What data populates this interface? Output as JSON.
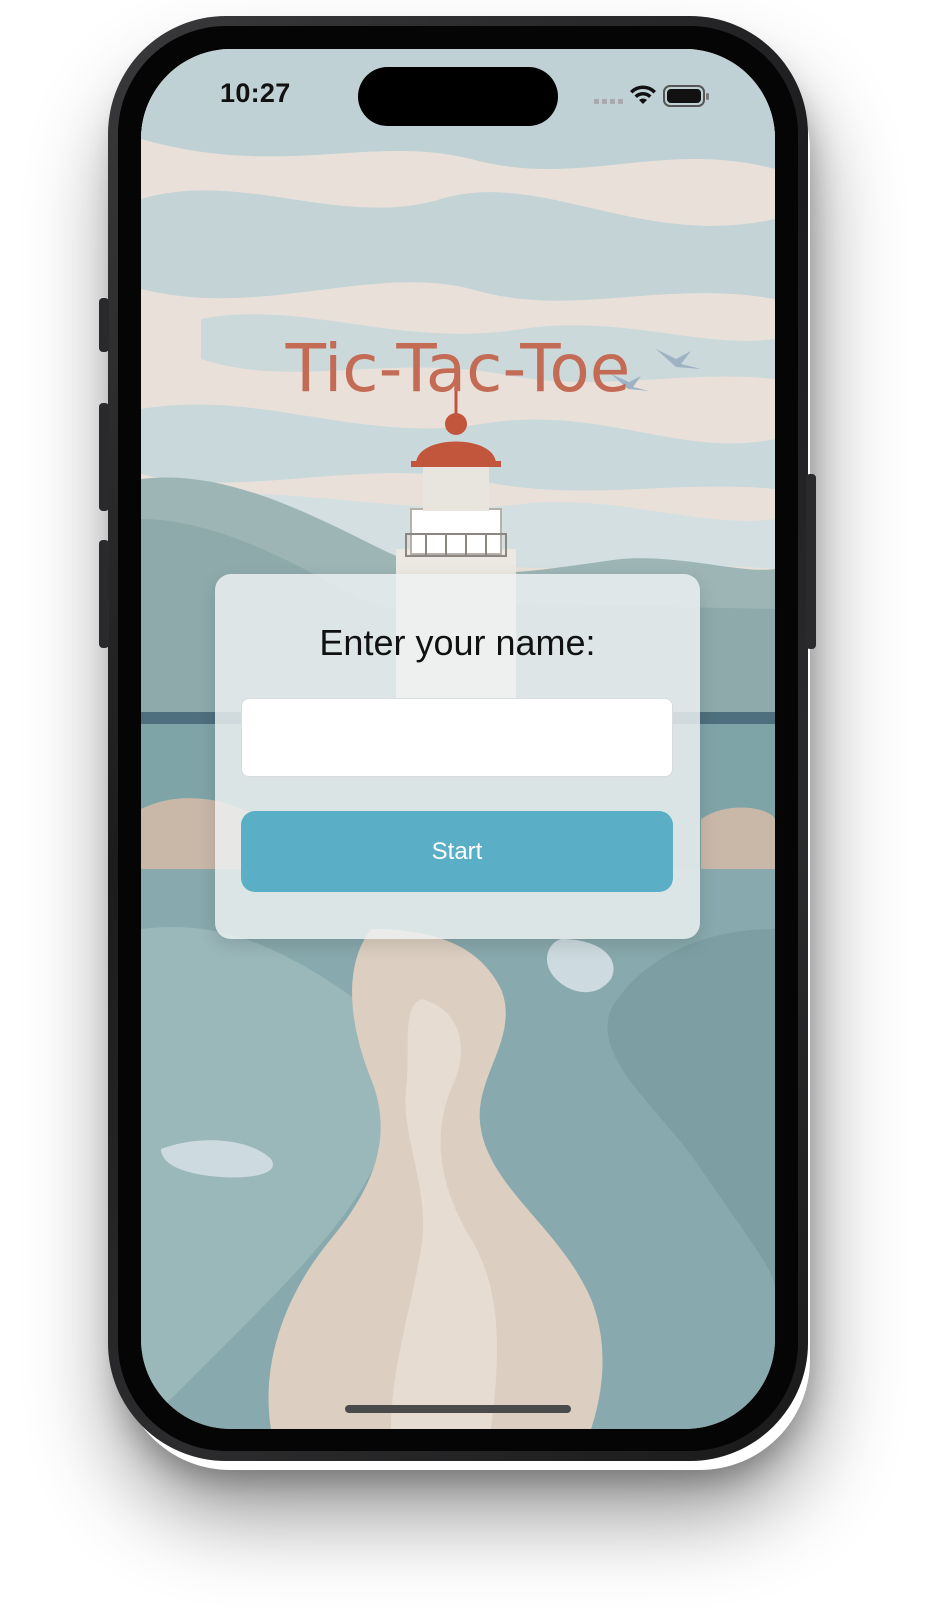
{
  "status_bar": {
    "time": "10:27",
    "icons": [
      "signal-icon",
      "wifi-icon",
      "battery-icon"
    ]
  },
  "app": {
    "title": "Tic-Tac-Toe",
    "colors": {
      "title": "#c46b55",
      "button": "#5aaec5",
      "card": "#eef2f3"
    }
  },
  "form": {
    "label": "Enter your name:",
    "name_value": "",
    "name_placeholder": "",
    "start_label": "Start"
  }
}
